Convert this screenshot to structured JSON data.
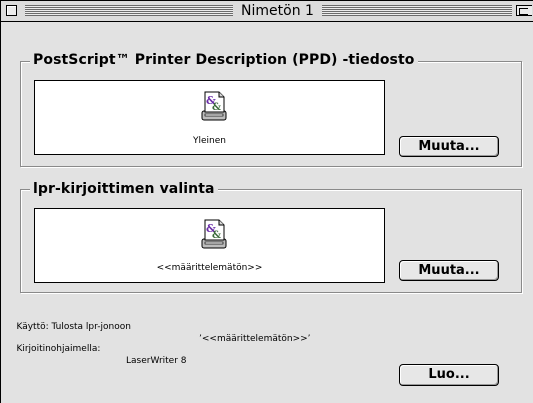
{
  "window": {
    "title": "Nimetön 1"
  },
  "ppd_group": {
    "label": "PostScript™ Printer Description (PPD) -tiedosto",
    "file_name": "Yleinen",
    "change_button": "Muuta..."
  },
  "lpr_group": {
    "label": "lpr-kirjoittimen valinta",
    "printer_name": "<<määrittelemätön>>",
    "change_button": "Muuta..."
  },
  "info": {
    "usage_label": "Käyttö: Tulosta lpr-jonoon",
    "usage_value": "’<<määrittelemätön>>’",
    "driver_label": "Kirjoitinohjaimella:",
    "driver_value": "LaserWriter 8"
  },
  "actions": {
    "create_button": "Luo..."
  },
  "icons": {
    "close": "close-box-icon",
    "zoom": "zoom-box-icon",
    "document": "document-icon"
  }
}
